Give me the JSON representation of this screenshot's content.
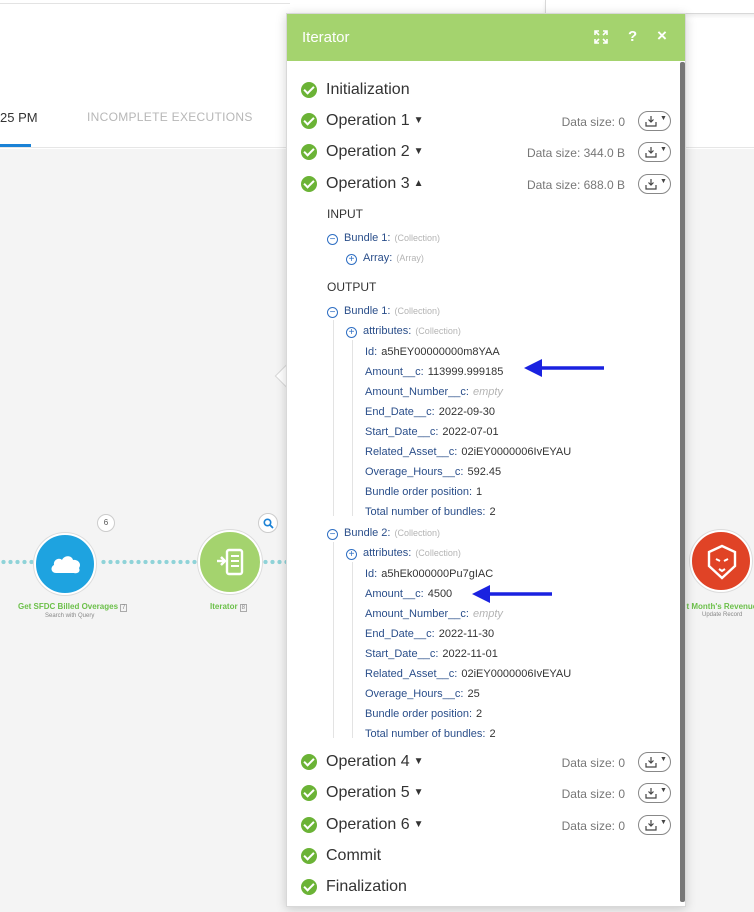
{
  "background": {
    "tab_time": "25 PM",
    "tab_incomplete": "INCOMPLETE EXECUTIONS"
  },
  "canvas": {
    "salesforce_node": {
      "label": "Get SFDC Billed Overages",
      "number": "7",
      "subtitle": "Search with Query",
      "badge": "6",
      "icon": "salesforce-cloud-icon"
    },
    "iterator_node": {
      "label": "Iterator",
      "number": "8",
      "icon": "iterator-icon"
    },
    "record_node": {
      "label": "st Month's Revenue to be R",
      "subtitle": "Update Record",
      "icon": "lion-icon"
    }
  },
  "panel": {
    "title": "Iterator",
    "header_icons": [
      "expand-icon",
      "help-icon",
      "close-icon"
    ],
    "help_glyph": "?",
    "close_glyph": "×",
    "operations": [
      {
        "label": "Initialization"
      },
      {
        "label": "Operation 1",
        "caret": "▼",
        "data_size": "Data size: 0"
      },
      {
        "label": "Operation 2",
        "caret": "▼",
        "data_size": "Data size: 344.0 B"
      },
      {
        "label": "Operation 3",
        "caret": "▲",
        "data_size": "Data size: 688.0 B"
      },
      {
        "label": "Operation 4",
        "caret": "▼",
        "data_size": "Data size: 0"
      },
      {
        "label": "Operation 5",
        "caret": "▼",
        "data_size": "Data size: 0"
      },
      {
        "label": "Operation 6",
        "caret": "▼",
        "data_size": "Data size: 0"
      },
      {
        "label": "Commit"
      },
      {
        "label": "Finalization"
      }
    ],
    "input": {
      "label": "INPUT",
      "bundle": {
        "key": "Bundle 1:",
        "type": "(Collection)"
      },
      "array": {
        "key": "Array:",
        "type": "(Array)"
      }
    },
    "output": {
      "label": "OUTPUT",
      "bundles": [
        {
          "key": "Bundle 1:",
          "type": "(Collection)",
          "attributes": {
            "key": "attributes:",
            "type": "(Collection)"
          },
          "fields": [
            {
              "key": "Id:",
              "value": "a5hEY00000000m8YAA"
            },
            {
              "key": "Amount__c:",
              "value": "113999.999185"
            },
            {
              "key": "Amount_Number__c:",
              "value": "empty"
            },
            {
              "key": "End_Date__c:",
              "value": "2022-09-30"
            },
            {
              "key": "Start_Date__c:",
              "value": "2022-07-01"
            },
            {
              "key": "Related_Asset__c:",
              "value": "02iEY0000006IvEYAU"
            },
            {
              "key": "Overage_Hours__c:",
              "value": "592.45"
            },
            {
              "key": "Bundle order position:",
              "value": "1"
            },
            {
              "key": "Total number of bundles:",
              "value": "2"
            }
          ]
        },
        {
          "key": "Bundle 2:",
          "type": "(Collection)",
          "attributes": {
            "key": "attributes:",
            "type": "(Collection)"
          },
          "fields": [
            {
              "key": "Id:",
              "value": "a5hEk000000Pu7gIAC"
            },
            {
              "key": "Amount__c:",
              "value": "4500"
            },
            {
              "key": "Amount_Number__c:",
              "value": "empty"
            },
            {
              "key": "End_Date__c:",
              "value": "2022-11-30"
            },
            {
              "key": "Start_Date__c:",
              "value": "2022-11-01"
            },
            {
              "key": "Related_Asset__c:",
              "value": "02iEY0000006IvEYAU"
            },
            {
              "key": "Overage_Hours__c:",
              "value": "25"
            },
            {
              "key": "Bundle order position:",
              "value": "2"
            },
            {
              "key": "Total number of bundles:",
              "value": "2"
            }
          ]
        }
      ]
    }
  },
  "annotations": [
    "arrow-left-icon",
    "arrow-left-icon"
  ],
  "colors": {
    "header_green": "#a4d36e",
    "check_green": "#6bb336",
    "key_blue": "#2a4e8a",
    "arrow_blue": "#1a22e0",
    "salesforce_blue": "#1ea3e0",
    "record_red": "#e04326"
  }
}
